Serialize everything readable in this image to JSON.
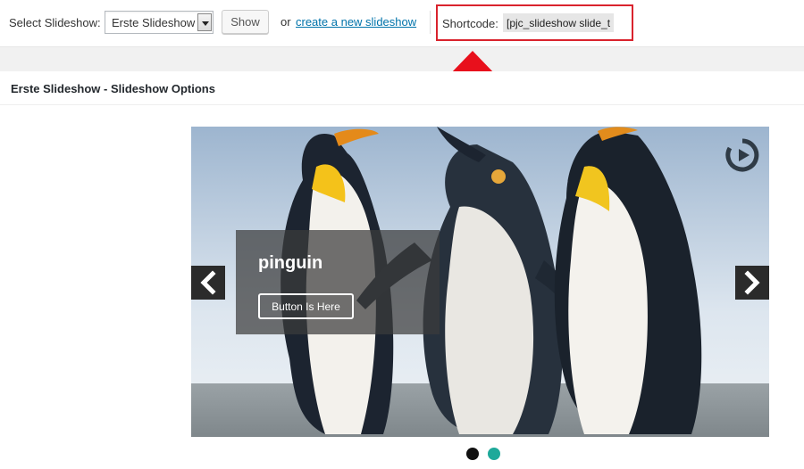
{
  "toolbar": {
    "select_label": "Select Slideshow:",
    "selected_slideshow": "Erste Slideshow",
    "show_button": "Show",
    "or_text": "or",
    "create_link": "create a new slideshow",
    "shortcode_label": "Shortcode:",
    "shortcode_value": "[pjc_slideshow slide_t"
  },
  "options": {
    "header": "Erste Slideshow - Slideshow Options"
  },
  "slider": {
    "caption_title": "pinguin",
    "caption_button": "Button Is Here",
    "slide_count": 2,
    "active_slide": 1
  },
  "icons": {
    "prev": "chevron-left-icon",
    "next": "chevron-right-icon",
    "play": "play-circle-icon",
    "highlight_arrow": "up-arrow-icon"
  },
  "colors": {
    "link": "#0073aa",
    "highlight": "#d9232d",
    "dot_active": "#111111",
    "dot_inactive": "#1ea99a"
  }
}
